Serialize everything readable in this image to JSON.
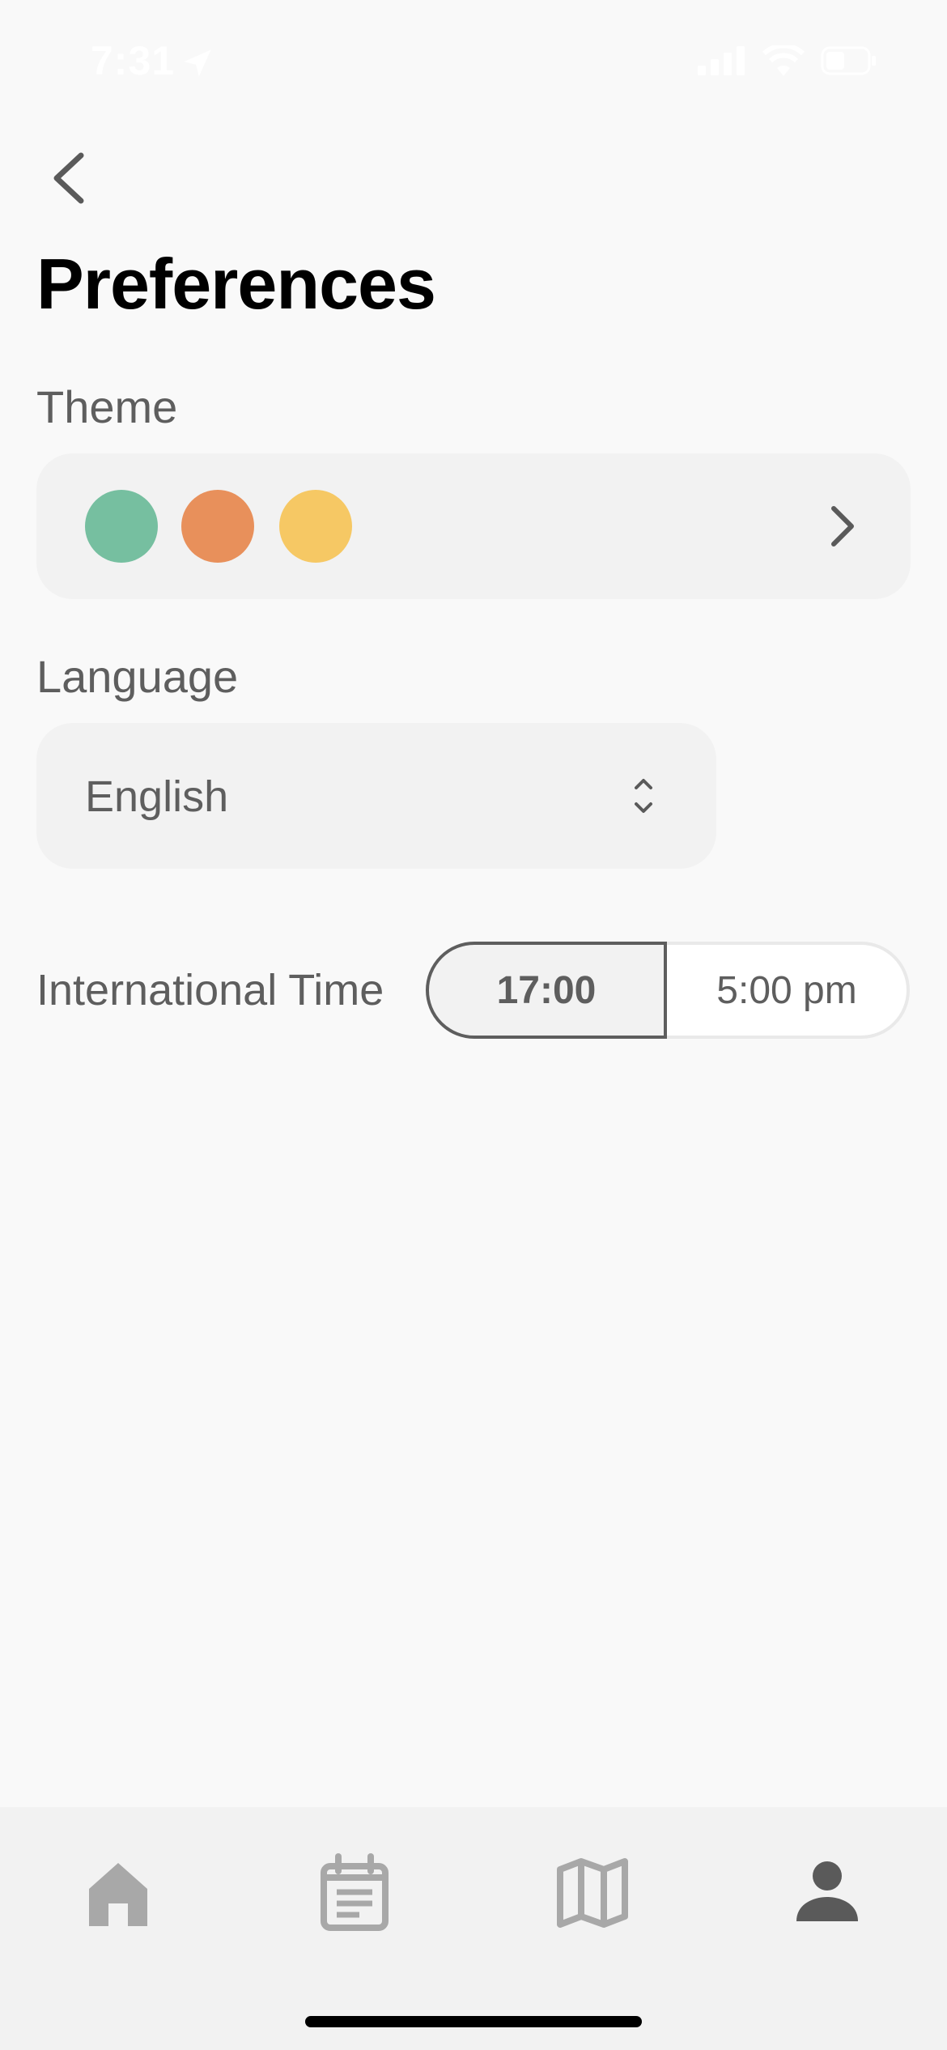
{
  "status_bar": {
    "time": "7:31",
    "icons": [
      "location-arrow-icon",
      "cellular-signal-icon",
      "wifi-icon",
      "battery-icon"
    ]
  },
  "header": {
    "back_icon": "chevron-left-icon",
    "title": "Preferences"
  },
  "theme": {
    "label": "Theme",
    "swatches": [
      "#76bfa0",
      "#e8905b",
      "#f6c864"
    ],
    "chevron_icon": "chevron-right-icon"
  },
  "language": {
    "label": "Language",
    "value": "English",
    "icon": "chevron-up-down-icon"
  },
  "time_format": {
    "label": "International Time",
    "options": [
      {
        "label": "17:00",
        "selected": true
      },
      {
        "label": "5:00 pm",
        "selected": false
      }
    ]
  },
  "tab_bar": {
    "tabs": [
      {
        "icon": "home-icon",
        "active": false
      },
      {
        "icon": "calendar-icon",
        "active": false
      },
      {
        "icon": "map-icon",
        "active": false
      },
      {
        "icon": "profile-icon",
        "active": true
      }
    ]
  },
  "colors": {
    "background": "#f9f9f9",
    "card": "#f2f2f2",
    "text": "#5e5e5e",
    "title": "#000000",
    "tab_inactive": "#a8a8a8",
    "tab_active": "#5a5a5a"
  }
}
